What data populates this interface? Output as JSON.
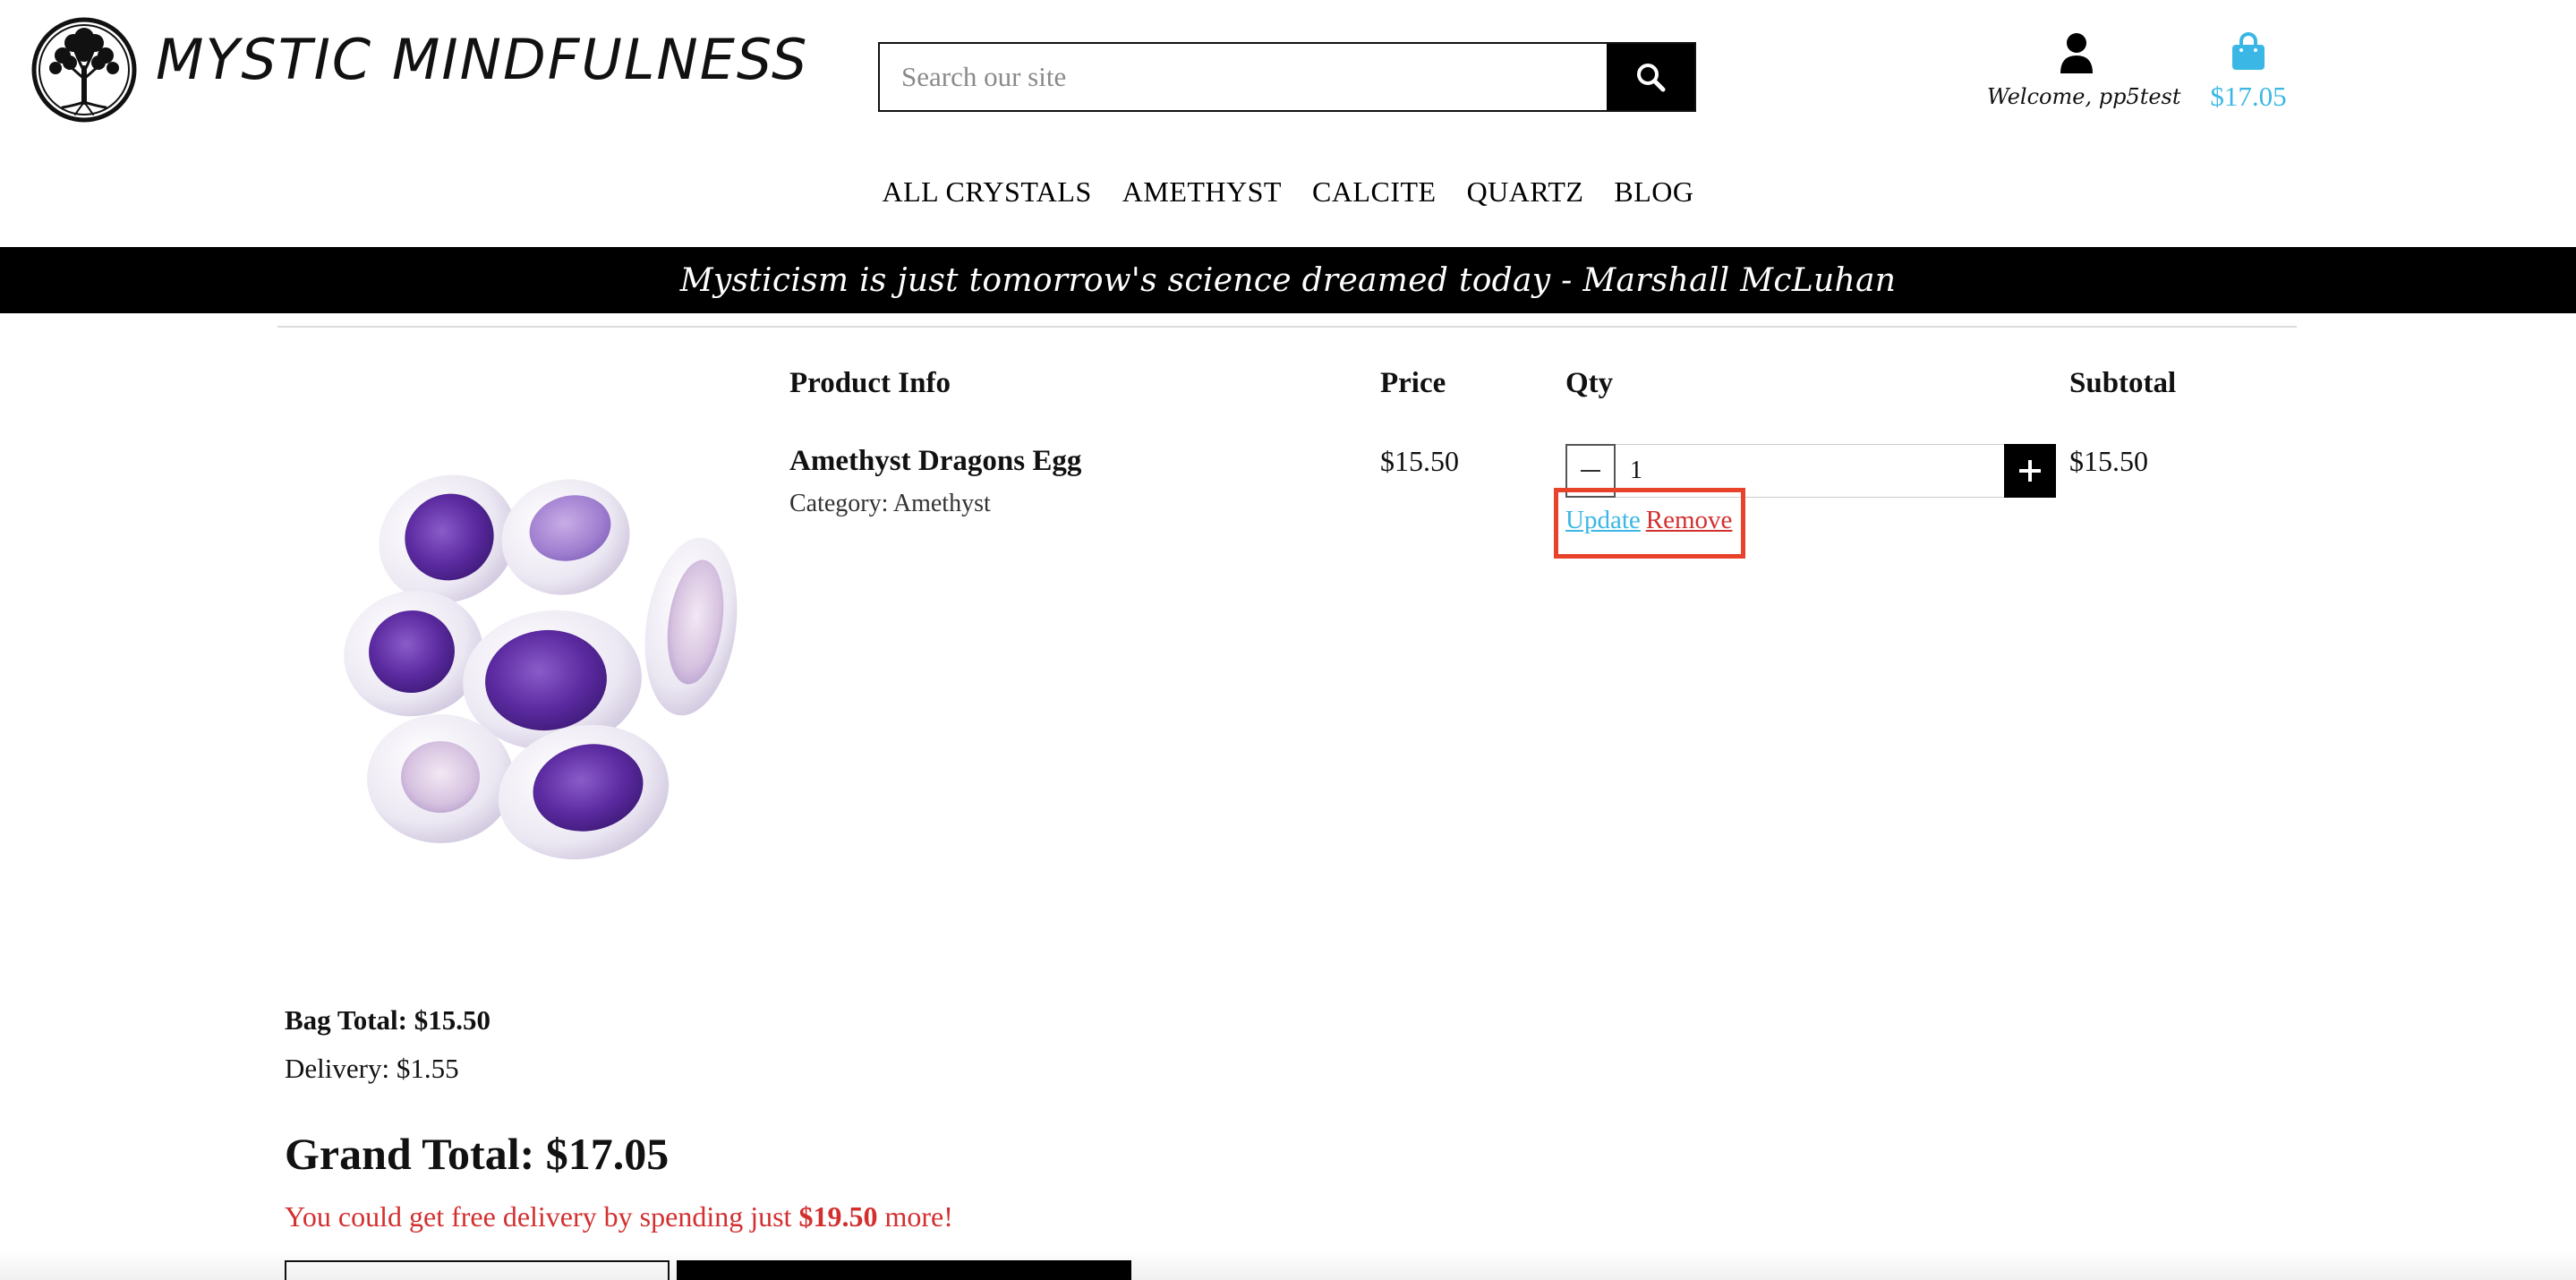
{
  "header": {
    "brand": "MYSTIC MINDFULNESS",
    "logo_icon": "tree-of-life-icon",
    "search": {
      "placeholder": "Search our site",
      "icon": "search-icon"
    },
    "account": {
      "icon": "user-icon",
      "welcome": "Welcome, pp5test"
    },
    "cart": {
      "icon": "shopping-bag-icon",
      "amount": "$17.05",
      "accent_color": "#3ab7e4"
    }
  },
  "nav": {
    "items": [
      {
        "label": "ALL CRYSTALS"
      },
      {
        "label": "AMETHYST"
      },
      {
        "label": "CALCITE"
      },
      {
        "label": "QUARTZ"
      },
      {
        "label": "BLOG"
      }
    ]
  },
  "banner": {
    "quote": "Mysticism is just tomorrow's science dreamed today - Marshall McLuhan"
  },
  "bag": {
    "columns": {
      "product_info": "Product Info",
      "price": "Price",
      "qty": "Qty",
      "subtotal": "Subtotal"
    },
    "items": [
      {
        "name": "Amethyst Dragons Egg",
        "category": "Category: Amethyst",
        "price": "$15.50",
        "qty": "1",
        "subtotal": "$15.50",
        "update_label": "Update",
        "remove_label": "Remove"
      }
    ]
  },
  "totals": {
    "bag_total": "Bag Total: $15.50",
    "delivery": "Delivery: $1.55",
    "grand_total": "Grand Total: $17.05",
    "free_delivery": {
      "prefix": "You could get free delivery by spending just",
      "amount": "$19.50",
      "suffix": "more!"
    }
  },
  "colors": {
    "accent_blue": "#3ab7e4",
    "alert_red": "#d32f2f",
    "highlight_box": "#e8432a",
    "banner_bg": "#000000"
  }
}
